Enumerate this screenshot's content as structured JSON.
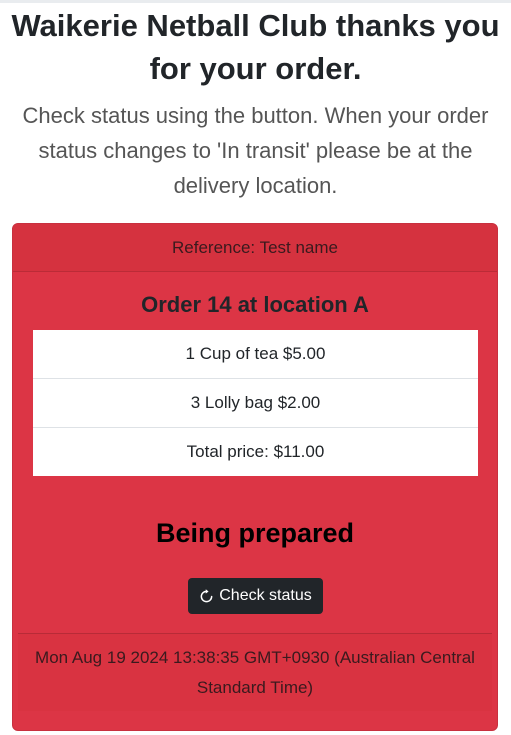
{
  "header": {
    "title": "Waikerie Netball Club thanks you for your order.",
    "subtitle": "Check status using the button. When your order status changes to 'In transit' please be at the delivery location."
  },
  "order": {
    "reference": "Reference: Test name",
    "heading": "Order 14 at location A",
    "items": [
      {
        "label": "1 Cup of tea $5.00"
      },
      {
        "label": "3 Lolly bag $2.00"
      },
      {
        "label": "Total price: $11.00"
      }
    ],
    "status": "Being prepared",
    "check_button_label": "Check status",
    "check_button_icon": "refresh-icon",
    "timestamp": "Mon Aug 19 2024 13:38:35 GMT+0930 (Australian Central Standard Time)"
  },
  "colors": {
    "card": "#dc3545",
    "button": "#212529"
  }
}
